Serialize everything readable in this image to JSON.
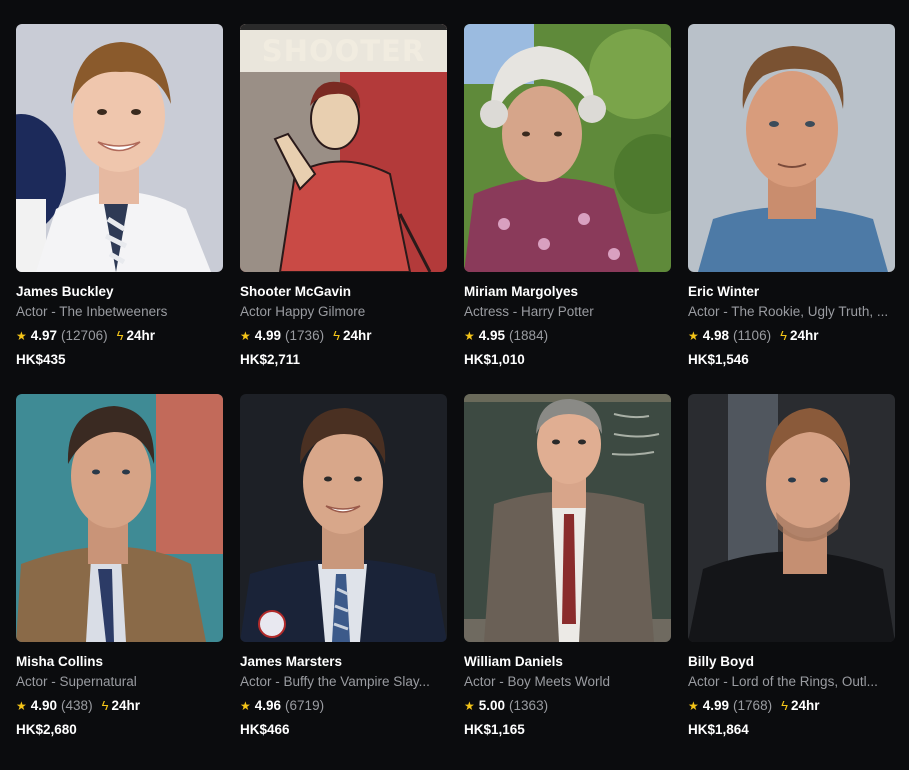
{
  "colors": {
    "background": "#0b0c0e",
    "accent": "#f5c518",
    "muted_text": "#9a9ca1"
  },
  "icons": {
    "star": "★",
    "bolt": "ϟ"
  },
  "cards": [
    {
      "name": "James Buckley",
      "role": "Actor - The Inbetweeners",
      "rating": "4.97",
      "count": "(12706)",
      "fast": "24hr",
      "price": "HK$435"
    },
    {
      "name": "Shooter McGavin",
      "role": "Actor Happy Gilmore",
      "rating": "4.99",
      "count": "(1736)",
      "fast": "24hr",
      "price": "HK$2,711",
      "photo_text": "SHOOTER"
    },
    {
      "name": "Miriam Margolyes",
      "role": "Actress - Harry Potter",
      "rating": "4.95",
      "count": "(1884)",
      "fast": "",
      "price": "HK$1,010"
    },
    {
      "name": "Eric Winter",
      "role": "Actor - The Rookie, Ugly Truth, ...",
      "rating": "4.98",
      "count": "(1106)",
      "fast": "24hr",
      "price": "HK$1,546"
    },
    {
      "name": "Misha Collins",
      "role": "Actor - Supernatural",
      "rating": "4.90",
      "count": "(438)",
      "fast": "24hr",
      "price": "HK$2,680"
    },
    {
      "name": "James Marsters",
      "role": "Actor - Buffy the Vampire Slay...",
      "rating": "4.96",
      "count": "(6719)",
      "fast": "",
      "price": "HK$466",
      "photo_text": "I VOTED"
    },
    {
      "name": "William Daniels",
      "role": "Actor - Boy Meets World",
      "rating": "5.00",
      "count": "(1363)",
      "fast": "",
      "price": "HK$1,165"
    },
    {
      "name": "Billy Boyd",
      "role": "Actor - Lord of the Rings, Outl...",
      "rating": "4.99",
      "count": "(1768)",
      "fast": "24hr",
      "price": "HK$1,864"
    }
  ]
}
